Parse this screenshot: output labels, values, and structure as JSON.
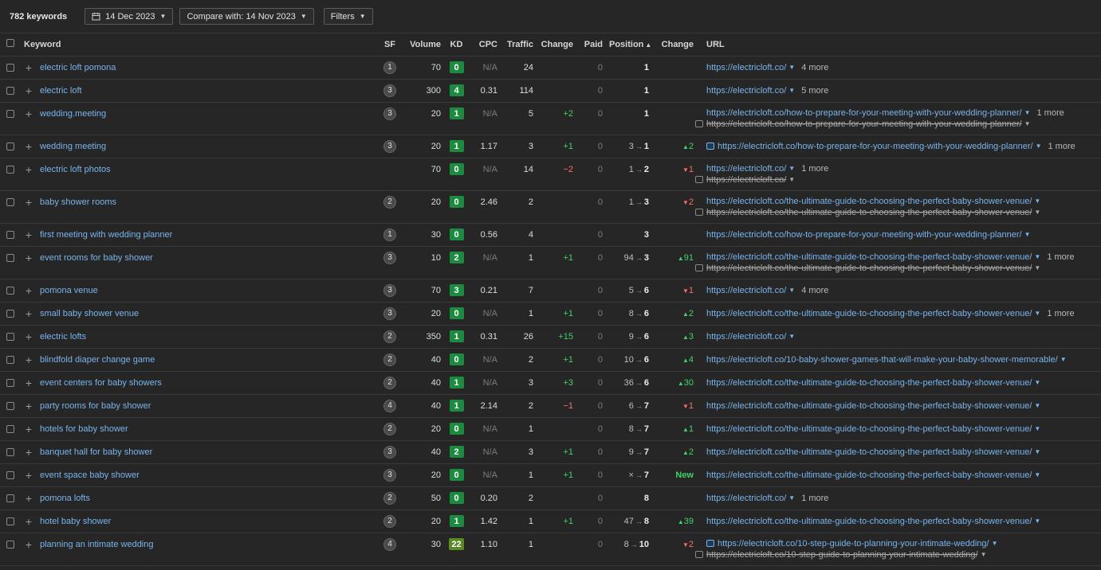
{
  "toolbar": {
    "keyword_count": "782 keywords",
    "date": "14 Dec 2023",
    "compare": "Compare with: 14 Nov 2023",
    "filters": "Filters"
  },
  "columns": [
    "Keyword",
    "SF",
    "Volume",
    "KD",
    "CPC",
    "Traffic",
    "Change",
    "Paid",
    "Position",
    "Change",
    "URL"
  ],
  "rows": [
    {
      "keyword": "electric loft pomona",
      "sf": "1",
      "volume": "70",
      "kd": "0",
      "cpc": "N/A",
      "traffic": "24",
      "tchange": "",
      "paid": "0",
      "pos_from": "",
      "pos": "1",
      "pchange": "",
      "pdir": "",
      "url": "https://electricloft.co/",
      "url_icon": false,
      "more": "4 more",
      "old_url": ""
    },
    {
      "keyword": "electric loft",
      "sf": "3",
      "volume": "300",
      "kd": "4",
      "cpc": "0.31",
      "traffic": "114",
      "tchange": "",
      "paid": "0",
      "pos_from": "",
      "pos": "1",
      "pchange": "",
      "pdir": "",
      "url": "https://electricloft.co/",
      "url_icon": false,
      "more": "5 more",
      "old_url": ""
    },
    {
      "keyword": "wedding.meeting",
      "sf": "3",
      "volume": "20",
      "kd": "1",
      "cpc": "N/A",
      "traffic": "5",
      "tchange": "+2",
      "paid": "0",
      "pos_from": "",
      "pos": "1",
      "pchange": "",
      "pdir": "",
      "url": "https://electricloft.co/how-to-prepare-for-your-meeting-with-your-wedding-planner/",
      "url_icon": false,
      "more": "1 more",
      "old_url": "https://electricloft.co/how-to-prepare-for-your-meeting-with-your-wedding-planner/"
    },
    {
      "keyword": "wedding meeting",
      "sf": "3",
      "volume": "20",
      "kd": "1",
      "cpc": "1.17",
      "traffic": "3",
      "tchange": "+1",
      "paid": "0",
      "pos_from": "3",
      "pos": "1",
      "pchange": "2",
      "pdir": "up",
      "url": "https://electricloft.co/how-to-prepare-for-your-meeting-with-your-wedding-planner/",
      "url_icon": true,
      "more": "1 more",
      "old_url": ""
    },
    {
      "keyword": "electric loft photos",
      "sf": "",
      "volume": "70",
      "kd": "0",
      "cpc": "N/A",
      "traffic": "14",
      "tchange": "−2",
      "paid": "0",
      "pos_from": "1",
      "pos": "2",
      "pchange": "1",
      "pdir": "down",
      "url": "https://electricloft.co/",
      "url_icon": false,
      "more": "1 more",
      "old_url": "https://electricloft.co/"
    },
    {
      "keyword": "baby shower rooms",
      "sf": "2",
      "volume": "20",
      "kd": "0",
      "cpc": "2.46",
      "traffic": "2",
      "tchange": "",
      "paid": "0",
      "pos_from": "1",
      "pos": "3",
      "pchange": "2",
      "pdir": "down",
      "url": "https://electricloft.co/the-ultimate-guide-to-choosing-the-perfect-baby-shower-venue/",
      "url_icon": false,
      "more": "",
      "old_url": "https://electricloft.co/the-ultimate-guide-to-choosing-the-perfect-baby-shower-venue/"
    },
    {
      "keyword": "first meeting with wedding planner",
      "sf": "1",
      "volume": "30",
      "kd": "0",
      "cpc": "0.56",
      "traffic": "4",
      "tchange": "",
      "paid": "0",
      "pos_from": "",
      "pos": "3",
      "pchange": "",
      "pdir": "",
      "url": "https://electricloft.co/how-to-prepare-for-your-meeting-with-your-wedding-planner/",
      "url_icon": false,
      "more": "",
      "old_url": ""
    },
    {
      "keyword": "event rooms for baby shower",
      "sf": "3",
      "volume": "10",
      "kd": "2",
      "cpc": "N/A",
      "traffic": "1",
      "tchange": "+1",
      "paid": "0",
      "pos_from": "94",
      "pos": "3",
      "pchange": "91",
      "pdir": "up",
      "url": "https://electricloft.co/the-ultimate-guide-to-choosing-the-perfect-baby-shower-venue/",
      "url_icon": false,
      "more": "1 more",
      "old_url": "https://electricloft.co/the-ultimate-guide-to-choosing-the-perfect-baby-shower-venue/"
    },
    {
      "keyword": "pomona venue",
      "sf": "3",
      "volume": "70",
      "kd": "3",
      "cpc": "0.21",
      "traffic": "7",
      "tchange": "",
      "paid": "0",
      "pos_from": "5",
      "pos": "6",
      "pchange": "1",
      "pdir": "down",
      "url": "https://electricloft.co/",
      "url_icon": false,
      "more": "4 more",
      "old_url": ""
    },
    {
      "keyword": "small baby shower venue",
      "sf": "3",
      "volume": "20",
      "kd": "0",
      "cpc": "N/A",
      "traffic": "1",
      "tchange": "+1",
      "paid": "0",
      "pos_from": "8",
      "pos": "6",
      "pchange": "2",
      "pdir": "up",
      "url": "https://electricloft.co/the-ultimate-guide-to-choosing-the-perfect-baby-shower-venue/",
      "url_icon": false,
      "more": "1 more",
      "old_url": ""
    },
    {
      "keyword": "electric lofts",
      "sf": "2",
      "volume": "350",
      "kd": "1",
      "cpc": "0.31",
      "traffic": "26",
      "tchange": "+15",
      "paid": "0",
      "pos_from": "9",
      "pos": "6",
      "pchange": "3",
      "pdir": "up",
      "url": "https://electricloft.co/",
      "url_icon": false,
      "more": "",
      "old_url": ""
    },
    {
      "keyword": "blindfold diaper change game",
      "sf": "2",
      "volume": "40",
      "kd": "0",
      "cpc": "N/A",
      "traffic": "2",
      "tchange": "+1",
      "paid": "0",
      "pos_from": "10",
      "pos": "6",
      "pchange": "4",
      "pdir": "up",
      "url": "https://electricloft.co/10-baby-shower-games-that-will-make-your-baby-shower-memorable/",
      "url_icon": false,
      "more": "",
      "old_url": ""
    },
    {
      "keyword": "event centers for baby showers",
      "sf": "2",
      "volume": "40",
      "kd": "1",
      "cpc": "N/A",
      "traffic": "3",
      "tchange": "+3",
      "paid": "0",
      "pos_from": "36",
      "pos": "6",
      "pchange": "30",
      "pdir": "up",
      "url": "https://electricloft.co/the-ultimate-guide-to-choosing-the-perfect-baby-shower-venue/",
      "url_icon": false,
      "more": "",
      "old_url": ""
    },
    {
      "keyword": "party rooms for baby shower",
      "sf": "4",
      "volume": "40",
      "kd": "1",
      "cpc": "2.14",
      "traffic": "2",
      "tchange": "−1",
      "paid": "0",
      "pos_from": "6",
      "pos": "7",
      "pchange": "1",
      "pdir": "down",
      "url": "https://electricloft.co/the-ultimate-guide-to-choosing-the-perfect-baby-shower-venue/",
      "url_icon": false,
      "more": "",
      "old_url": ""
    },
    {
      "keyword": "hotels for baby shower",
      "sf": "2",
      "volume": "20",
      "kd": "0",
      "cpc": "N/A",
      "traffic": "1",
      "tchange": "",
      "paid": "0",
      "pos_from": "8",
      "pos": "7",
      "pchange": "1",
      "pdir": "up",
      "url": "https://electricloft.co/the-ultimate-guide-to-choosing-the-perfect-baby-shower-venue/",
      "url_icon": false,
      "more": "",
      "old_url": ""
    },
    {
      "keyword": "banquet hall for baby shower",
      "sf": "3",
      "volume": "40",
      "kd": "2",
      "cpc": "N/A",
      "traffic": "3",
      "tchange": "+1",
      "paid": "0",
      "pos_from": "9",
      "pos": "7",
      "pchange": "2",
      "pdir": "up",
      "url": "https://electricloft.co/the-ultimate-guide-to-choosing-the-perfect-baby-shower-venue/",
      "url_icon": false,
      "more": "",
      "old_url": ""
    },
    {
      "keyword": "event space baby shower",
      "sf": "3",
      "volume": "20",
      "kd": "0",
      "cpc": "N/A",
      "traffic": "1",
      "tchange": "+1",
      "paid": "0",
      "pos_from": "×",
      "pos": "7",
      "pchange": "New",
      "pdir": "new",
      "url": "https://electricloft.co/the-ultimate-guide-to-choosing-the-perfect-baby-shower-venue/",
      "url_icon": false,
      "more": "",
      "old_url": ""
    },
    {
      "keyword": "pomona lofts",
      "sf": "2",
      "volume": "50",
      "kd": "0",
      "cpc": "0.20",
      "traffic": "2",
      "tchange": "",
      "paid": "0",
      "pos_from": "",
      "pos": "8",
      "pchange": "",
      "pdir": "",
      "url": "https://electricloft.co/",
      "url_icon": false,
      "more": "1 more",
      "old_url": ""
    },
    {
      "keyword": "hotel baby shower",
      "sf": "2",
      "volume": "20",
      "kd": "1",
      "cpc": "1.42",
      "traffic": "1",
      "tchange": "+1",
      "paid": "0",
      "pos_from": "47",
      "pos": "8",
      "pchange": "39",
      "pdir": "up",
      "url": "https://electricloft.co/the-ultimate-guide-to-choosing-the-perfect-baby-shower-venue/",
      "url_icon": false,
      "more": "",
      "old_url": ""
    },
    {
      "keyword": "planning an intimate wedding",
      "sf": "4",
      "volume": "30",
      "kd": "22",
      "cpc": "1.10",
      "traffic": "1",
      "tchange": "",
      "paid": "0",
      "pos_from": "8",
      "pos": "10",
      "pchange": "2",
      "pdir": "down",
      "url": "https://electricloft.co/10-step-guide-to-planning-your-intimate-wedding/",
      "url_icon": true,
      "more": "",
      "old_url": "https://electricloft.co/10-step-guide-to-planning-your-intimate-wedding/"
    }
  ],
  "colors": {
    "link": "#79b4ec",
    "up": "#3fd36a",
    "down": "#ff6b6b",
    "kd_easy": "#1c8a3f",
    "kd_medium": "#5a8a26"
  }
}
